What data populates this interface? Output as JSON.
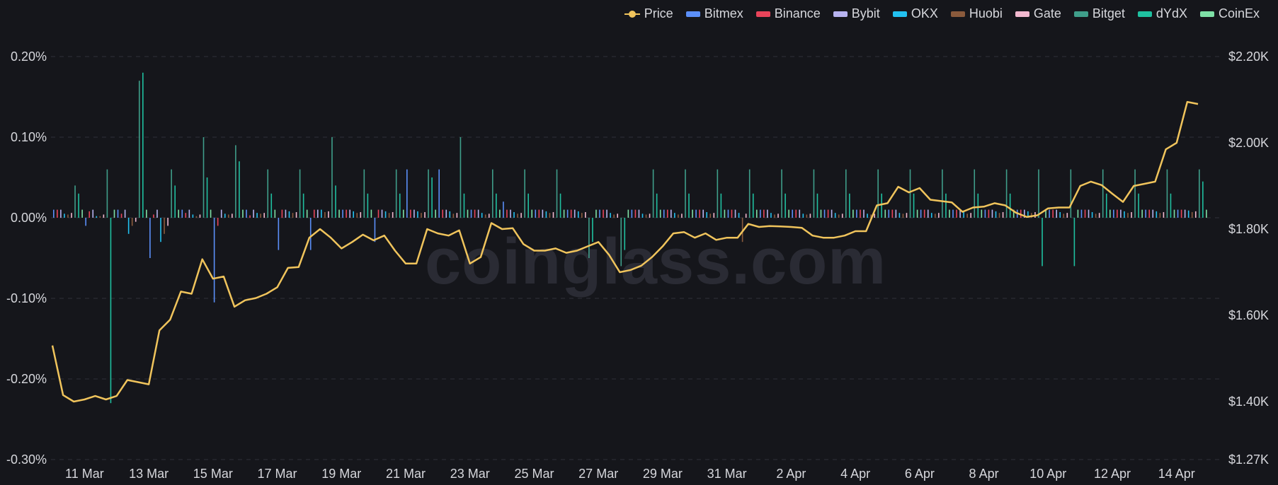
{
  "colors": {
    "background": "#15161b",
    "grid": "#2e3038",
    "text": "#d6d7dc",
    "price": "#f0c45c",
    "bitmex": "#5b8ff9",
    "binance": "#e8445a",
    "bybit": "#b7b3f0",
    "okx": "#22c1f0",
    "huobi": "#8a5a3c",
    "gate": "#f2b8cf",
    "bitget": "#3f9e8a",
    "dydx": "#1fc0a0",
    "coinex": "#7ee0a6"
  },
  "watermark": "coinglass.com",
  "legend": [
    {
      "label": "Price",
      "color": "#f0c45c",
      "kind": "line"
    },
    {
      "label": "Bitmex",
      "color": "#5b8ff9",
      "kind": "bar"
    },
    {
      "label": "Binance",
      "color": "#e8445a",
      "kind": "bar"
    },
    {
      "label": "Bybit",
      "color": "#b7b3f0",
      "kind": "bar"
    },
    {
      "label": "OKX",
      "color": "#22c1f0",
      "kind": "bar"
    },
    {
      "label": "Huobi",
      "color": "#8a5a3c",
      "kind": "bar"
    },
    {
      "label": "Gate",
      "color": "#f2b8cf",
      "kind": "bar"
    },
    {
      "label": "Bitget",
      "color": "#3f9e8a",
      "kind": "bar"
    },
    {
      "label": "dYdX",
      "color": "#1fc0a0",
      "kind": "bar"
    },
    {
      "label": "CoinEx",
      "color": "#7ee0a6",
      "kind": "bar"
    }
  ],
  "chart_data": {
    "type": "bar+line",
    "title": "",
    "x_start": "2023-03-10",
    "x_end": "2023-04-14",
    "x_tick_labels": [
      "11 Mar",
      "13 Mar",
      "15 Mar",
      "17 Mar",
      "19 Mar",
      "21 Mar",
      "23 Mar",
      "25 Mar",
      "27 Mar",
      "29 Mar",
      "31 Mar",
      "2 Apr",
      "4 Apr",
      "6 Apr",
      "8 Apr",
      "10 Apr",
      "12 Apr",
      "14 Apr"
    ],
    "y_left": {
      "ticks": [
        "0.20%",
        "0.10%",
        "0.00%",
        "-0.10%",
        "-0.20%",
        "-0.30%"
      ],
      "values": [
        0.2,
        0.1,
        0.0,
        -0.1,
        -0.2,
        -0.3
      ],
      "range": [
        -0.3,
        0.2
      ]
    },
    "y_right": {
      "ticks": [
        "$2.20K",
        "$2.00K",
        "$1.80K",
        "$1.60K",
        "$1.40K",
        "$1.27K"
      ],
      "values": [
        2200,
        2000,
        1800,
        1600,
        1400,
        1270
      ],
      "range": [
        1270,
        2200
      ]
    },
    "grid": true,
    "legend_position": "top-right",
    "price": {
      "name": "Price",
      "points": [
        [
          "2023-03-10 00:00",
          1530
        ],
        [
          "2023-03-10 08:00",
          1415
        ],
        [
          "2023-03-10 16:00",
          1400
        ],
        [
          "2023-03-11 00:00",
          1405
        ],
        [
          "2023-03-11 08:00",
          1413
        ],
        [
          "2023-03-11 16:00",
          1405
        ],
        [
          "2023-03-12 00:00",
          1413
        ],
        [
          "2023-03-12 08:00",
          1450
        ],
        [
          "2023-03-12 16:00",
          1445
        ],
        [
          "2023-03-13 00:00",
          1440
        ],
        [
          "2023-03-13 08:00",
          1565
        ],
        [
          "2023-03-13 16:00",
          1590
        ],
        [
          "2023-03-14 00:00",
          1655
        ],
        [
          "2023-03-14 08:00",
          1650
        ],
        [
          "2023-03-14 16:00",
          1730
        ],
        [
          "2023-03-15 00:00",
          1685
        ],
        [
          "2023-03-15 08:00",
          1690
        ],
        [
          "2023-03-15 16:00",
          1620
        ],
        [
          "2023-03-16 00:00",
          1635
        ],
        [
          "2023-03-16 08:00",
          1640
        ],
        [
          "2023-03-16 16:00",
          1650
        ],
        [
          "2023-03-17 00:00",
          1665
        ],
        [
          "2023-03-17 08:00",
          1710
        ],
        [
          "2023-03-17 16:00",
          1712
        ],
        [
          "2023-03-18 00:00",
          1780
        ],
        [
          "2023-03-18 08:00",
          1800
        ],
        [
          "2023-03-18 16:00",
          1780
        ],
        [
          "2023-03-19 00:00",
          1755
        ],
        [
          "2023-03-19 08:00",
          1770
        ],
        [
          "2023-03-19 16:00",
          1787
        ],
        [
          "2023-03-20 00:00",
          1774
        ],
        [
          "2023-03-20 08:00",
          1785
        ],
        [
          "2023-03-20 16:00",
          1750
        ],
        [
          "2023-03-21 00:00",
          1720
        ],
        [
          "2023-03-21 08:00",
          1720
        ],
        [
          "2023-03-21 16:00",
          1800
        ],
        [
          "2023-03-22 00:00",
          1790
        ],
        [
          "2023-03-22 08:00",
          1785
        ],
        [
          "2023-03-22 16:00",
          1797
        ],
        [
          "2023-03-23 00:00",
          1720
        ],
        [
          "2023-03-23 08:00",
          1735
        ],
        [
          "2023-03-23 16:00",
          1814
        ],
        [
          "2023-03-24 00:00",
          1800
        ],
        [
          "2023-03-24 08:00",
          1802
        ],
        [
          "2023-03-24 16:00",
          1765
        ],
        [
          "2023-03-25 00:00",
          1750
        ],
        [
          "2023-03-25 08:00",
          1750
        ],
        [
          "2023-03-25 16:00",
          1755
        ],
        [
          "2023-03-26 00:00",
          1745
        ],
        [
          "2023-03-26 08:00",
          1750
        ],
        [
          "2023-03-26 16:00",
          1760
        ],
        [
          "2023-03-27 00:00",
          1770
        ],
        [
          "2023-03-27 08:00",
          1740
        ],
        [
          "2023-03-27 16:00",
          1700
        ],
        [
          "2023-03-28 00:00",
          1705
        ],
        [
          "2023-03-28 08:00",
          1715
        ],
        [
          "2023-03-28 16:00",
          1735
        ],
        [
          "2023-03-29 00:00",
          1760
        ],
        [
          "2023-03-29 08:00",
          1790
        ],
        [
          "2023-03-29 16:00",
          1793
        ],
        [
          "2023-03-30 00:00",
          1780
        ],
        [
          "2023-03-30 08:00",
          1790
        ],
        [
          "2023-03-30 16:00",
          1775
        ],
        [
          "2023-03-31 00:00",
          1780
        ],
        [
          "2023-03-31 08:00",
          1780
        ],
        [
          "2023-03-31 16:00",
          1812
        ],
        [
          "2023-04-01 00:00",
          1805
        ],
        [
          "2023-04-01 08:00",
          1807
        ],
        [
          "2023-04-01 16:00",
          1806
        ],
        [
          "2023-04-02 00:00",
          1805
        ],
        [
          "2023-04-02 08:00",
          1803
        ],
        [
          "2023-04-02 16:00",
          1785
        ],
        [
          "2023-04-03 00:00",
          1780
        ],
        [
          "2023-04-03 08:00",
          1780
        ],
        [
          "2023-04-03 16:00",
          1785
        ],
        [
          "2023-04-04 00:00",
          1795
        ],
        [
          "2023-04-04 08:00",
          1795
        ],
        [
          "2023-04-04 16:00",
          1855
        ],
        [
          "2023-04-05 00:00",
          1860
        ],
        [
          "2023-04-05 08:00",
          1898
        ],
        [
          "2023-04-05 16:00",
          1885
        ],
        [
          "2023-04-06 00:00",
          1895
        ],
        [
          "2023-04-06 08:00",
          1868
        ],
        [
          "2023-04-06 16:00",
          1865
        ],
        [
          "2023-04-07 00:00",
          1862
        ],
        [
          "2023-04-07 08:00",
          1840
        ],
        [
          "2023-04-07 16:00",
          1850
        ],
        [
          "2023-04-08 00:00",
          1852
        ],
        [
          "2023-04-08 08:00",
          1860
        ],
        [
          "2023-04-08 16:00",
          1855
        ],
        [
          "2023-04-09 00:00",
          1838
        ],
        [
          "2023-04-09 08:00",
          1828
        ],
        [
          "2023-04-09 16:00",
          1832
        ],
        [
          "2023-04-10 00:00",
          1848
        ],
        [
          "2023-04-10 08:00",
          1850
        ],
        [
          "2023-04-10 16:00",
          1850
        ],
        [
          "2023-04-11 00:00",
          1900
        ],
        [
          "2023-04-11 08:00",
          1910
        ],
        [
          "2023-04-11 16:00",
          1902
        ],
        [
          "2023-04-12 00:00",
          1882
        ],
        [
          "2023-04-12 08:00",
          1863
        ],
        [
          "2023-04-12 16:00",
          1900
        ],
        [
          "2023-04-13 00:00",
          1905
        ],
        [
          "2023-04-13 08:00",
          1910
        ],
        [
          "2023-04-13 16:00",
          1985
        ],
        [
          "2023-04-14 00:00",
          2000
        ],
        [
          "2023-04-14 08:00",
          2095
        ],
        [
          "2023-04-14 16:00",
          2090
        ]
      ]
    },
    "funding_rate_series": [
      {
        "name": "Bitmex",
        "values_pct": [
          0.01,
          -0.01,
          0.01,
          -0.05,
          0.01,
          -0.105,
          0.01,
          -0.04,
          -0.04,
          0.01,
          -0.03,
          0.06,
          0.06,
          0.01,
          0.02,
          0.01,
          0.01,
          0.01,
          0.01,
          0.01,
          0.01,
          0.01,
          0.01,
          0.01,
          0.01,
          0.01,
          0.01,
          0.01,
          0.01,
          0.01,
          0.01,
          0.01,
          0.01,
          0.01,
          0.01,
          0.01
        ]
      },
      {
        "name": "Binance",
        "values_pct": [
          0.01,
          0.008,
          0.005,
          0.004,
          0.006,
          -0.01,
          0.003,
          0.01,
          0.01,
          0.01,
          0.01,
          0.01,
          0.01,
          0.01,
          0.01,
          0.01,
          0.01,
          0.01,
          0.01,
          0.01,
          0.01,
          0.01,
          0.01,
          0.01,
          0.01,
          0.01,
          0.01,
          0.01,
          0.01,
          0.01,
          0.01,
          0.01,
          0.01,
          0.01,
          0.01,
          0.01
        ]
      },
      {
        "name": "Bybit",
        "values_pct": [
          0.01,
          0.01,
          0.01,
          0.01,
          0.01,
          0.01,
          0.01,
          0.01,
          0.01,
          0.01,
          0.01,
          0.01,
          0.01,
          0.01,
          0.01,
          0.01,
          0.01,
          0.01,
          0.01,
          0.01,
          0.01,
          0.01,
          0.01,
          0.01,
          0.01,
          0.01,
          0.01,
          0.01,
          0.01,
          0.01,
          0.01,
          0.01,
          0.01,
          0.01,
          0.01,
          0.01
        ]
      },
      {
        "name": "OKX",
        "values_pct": [
          0.005,
          0.002,
          -0.02,
          -0.03,
          0.004,
          0.005,
          0.006,
          0.008,
          0.01,
          0.008,
          0.008,
          0.008,
          0.008,
          0.006,
          0.007,
          0.008,
          0.008,
          0.006,
          0.005,
          0.006,
          0.007,
          0.006,
          0.006,
          0.005,
          0.006,
          0.005,
          0.006,
          0.006,
          0.007,
          0.008,
          0.008,
          0.007,
          0.007,
          0.008,
          0.008,
          0.009
        ]
      },
      {
        "name": "Huobi",
        "values_pct": [
          0.004,
          0.002,
          -0.01,
          -0.02,
          0.002,
          0.004,
          0.005,
          0.006,
          0.007,
          0.006,
          0.006,
          0.006,
          0.005,
          0.004,
          0.005,
          0.006,
          0.006,
          0.004,
          0.004,
          0.004,
          0.005,
          -0.03,
          0.004,
          0.004,
          0.004,
          0.004,
          0.005,
          0.005,
          0.005,
          0.006,
          0.006,
          0.005,
          0.005,
          0.006,
          0.006,
          0.007
        ]
      },
      {
        "name": "Gate",
        "values_pct": [
          0.006,
          0.004,
          -0.005,
          -0.01,
          0.004,
          0.005,
          0.006,
          0.007,
          0.008,
          0.007,
          0.007,
          0.007,
          0.006,
          0.005,
          0.006,
          0.007,
          0.007,
          0.005,
          0.005,
          0.005,
          0.006,
          0.005,
          0.005,
          0.005,
          0.005,
          0.005,
          0.006,
          0.006,
          0.006,
          0.007,
          0.007,
          0.006,
          0.006,
          0.007,
          0.007,
          0.008
        ]
      },
      {
        "name": "Bitget",
        "values_pct": [
          0.04,
          0.06,
          0.17,
          0.06,
          0.1,
          0.09,
          0.06,
          0.06,
          0.1,
          0.06,
          0.06,
          0.06,
          0.1,
          0.06,
          0.06,
          0.06,
          -0.05,
          -0.06,
          0.06,
          0.06,
          0.06,
          0.06,
          0.06,
          0.06,
          0.06,
          0.06,
          0.06,
          0.06,
          0.06,
          0.06,
          0.06,
          0.06,
          0.06,
          0.06,
          0.06,
          0.06
        ]
      },
      {
        "name": "dYdX",
        "values_pct": [
          0.03,
          -0.23,
          0.18,
          0.04,
          0.05,
          0.07,
          0.03,
          0.03,
          0.04,
          0.03,
          0.03,
          0.05,
          0.03,
          0.03,
          0.03,
          0.03,
          -0.03,
          -0.04,
          0.03,
          0.03,
          0.03,
          0.03,
          0.03,
          0.03,
          0.03,
          0.03,
          0.03,
          0.03,
          0.03,
          0.03,
          -0.06,
          -0.06,
          0.03,
          0.03,
          0.03,
          0.045
        ]
      },
      {
        "name": "CoinEx",
        "values_pct": [
          0.01,
          0.01,
          0.01,
          0.01,
          0.01,
          0.01,
          0.01,
          0.01,
          0.01,
          0.01,
          0.01,
          0.01,
          0.01,
          0.01,
          0.01,
          0.01,
          0.01,
          0.01,
          0.01,
          0.01,
          0.01,
          0.01,
          0.01,
          0.01,
          0.01,
          0.01,
          0.01,
          0.01,
          0.01,
          0.01,
          0.01,
          0.01,
          0.01,
          0.01,
          0.01,
          0.01
        ]
      }
    ]
  }
}
